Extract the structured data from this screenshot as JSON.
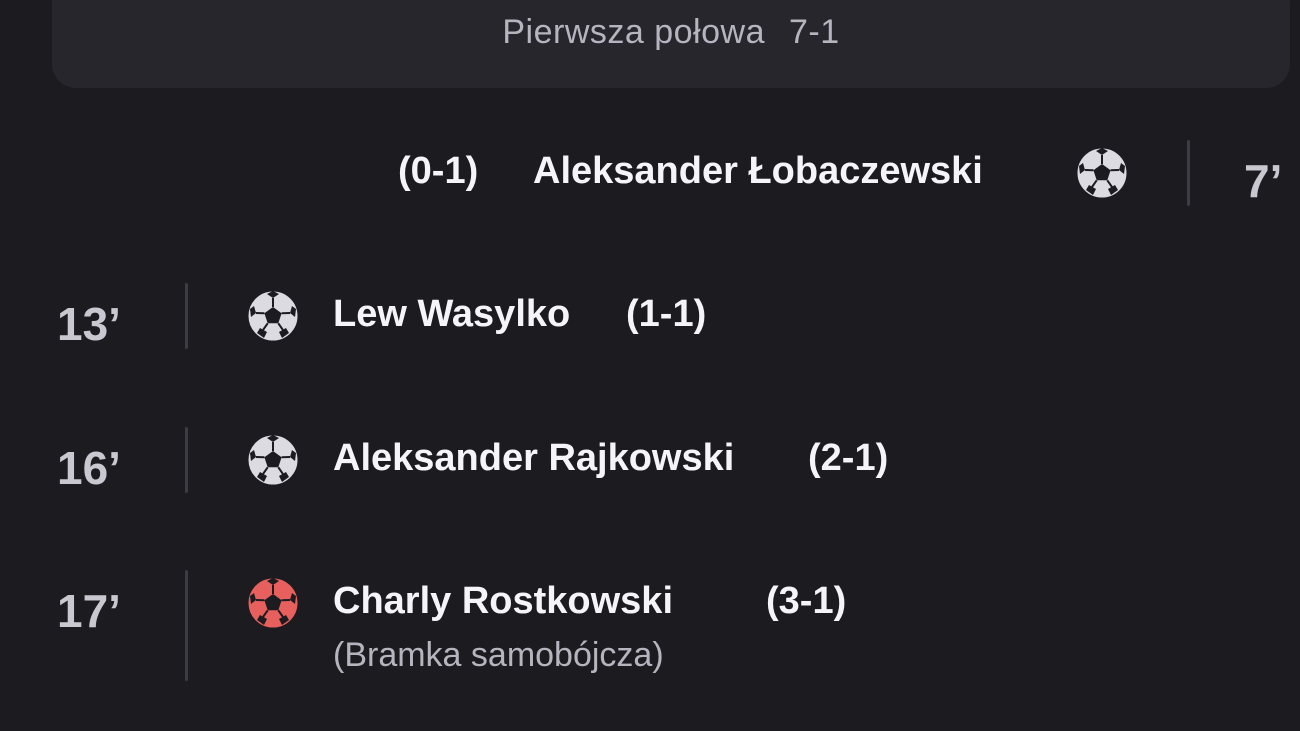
{
  "half_header": {
    "label": "Pierwsza połowa",
    "score": "7-1"
  },
  "events": [
    {
      "side": "away",
      "minute": "7’",
      "player": "Aleksander Łobaczewski",
      "score": "(0-1)",
      "icon": "soccer-ball-icon",
      "icon_color": "#dcdbe2"
    },
    {
      "side": "home",
      "minute": "13’",
      "player": "Lew Wasylko",
      "score": "(1-1)",
      "icon": "soccer-ball-icon",
      "icon_color": "#dcdbe2"
    },
    {
      "side": "home",
      "minute": "16’",
      "player": "Aleksander Rajkowski",
      "score": "(2-1)",
      "icon": "soccer-ball-icon",
      "icon_color": "#dcdbe2"
    },
    {
      "side": "home",
      "minute": "17’",
      "player": "Charly Rostkowski",
      "score": "(3-1)",
      "note": "(Bramka samobójcza)",
      "icon": "own-goal-ball-icon",
      "icon_color": "#e8605e"
    }
  ]
}
